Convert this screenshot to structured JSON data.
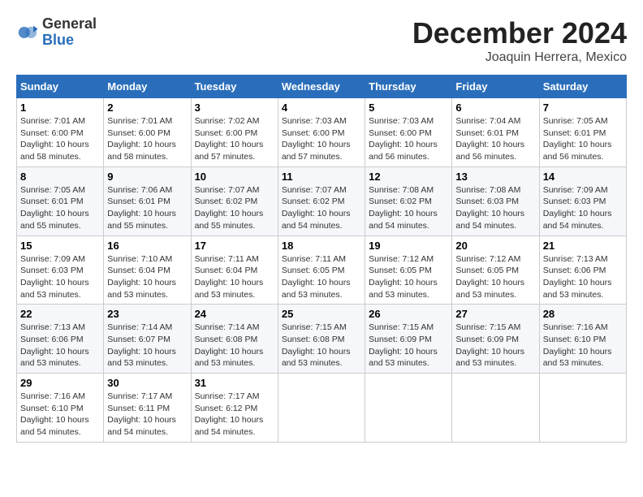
{
  "header": {
    "logo_general": "General",
    "logo_blue": "Blue",
    "title": "December 2024",
    "subtitle": "Joaquin Herrera, Mexico"
  },
  "days_of_week": [
    "Sunday",
    "Monday",
    "Tuesday",
    "Wednesday",
    "Thursday",
    "Friday",
    "Saturday"
  ],
  "weeks": [
    [
      {
        "day": "1",
        "sunrise": "7:01 AM",
        "sunset": "6:00 PM",
        "daylight": "10 hours and 58 minutes."
      },
      {
        "day": "2",
        "sunrise": "7:01 AM",
        "sunset": "6:00 PM",
        "daylight": "10 hours and 58 minutes."
      },
      {
        "day": "3",
        "sunrise": "7:02 AM",
        "sunset": "6:00 PM",
        "daylight": "10 hours and 57 minutes."
      },
      {
        "day": "4",
        "sunrise": "7:03 AM",
        "sunset": "6:00 PM",
        "daylight": "10 hours and 57 minutes."
      },
      {
        "day": "5",
        "sunrise": "7:03 AM",
        "sunset": "6:00 PM",
        "daylight": "10 hours and 56 minutes."
      },
      {
        "day": "6",
        "sunrise": "7:04 AM",
        "sunset": "6:01 PM",
        "daylight": "10 hours and 56 minutes."
      },
      {
        "day": "7",
        "sunrise": "7:05 AM",
        "sunset": "6:01 PM",
        "daylight": "10 hours and 56 minutes."
      }
    ],
    [
      {
        "day": "8",
        "sunrise": "7:05 AM",
        "sunset": "6:01 PM",
        "daylight": "10 hours and 55 minutes."
      },
      {
        "day": "9",
        "sunrise": "7:06 AM",
        "sunset": "6:01 PM",
        "daylight": "10 hours and 55 minutes."
      },
      {
        "day": "10",
        "sunrise": "7:07 AM",
        "sunset": "6:02 PM",
        "daylight": "10 hours and 55 minutes."
      },
      {
        "day": "11",
        "sunrise": "7:07 AM",
        "sunset": "6:02 PM",
        "daylight": "10 hours and 54 minutes."
      },
      {
        "day": "12",
        "sunrise": "7:08 AM",
        "sunset": "6:02 PM",
        "daylight": "10 hours and 54 minutes."
      },
      {
        "day": "13",
        "sunrise": "7:08 AM",
        "sunset": "6:03 PM",
        "daylight": "10 hours and 54 minutes."
      },
      {
        "day": "14",
        "sunrise": "7:09 AM",
        "sunset": "6:03 PM",
        "daylight": "10 hours and 54 minutes."
      }
    ],
    [
      {
        "day": "15",
        "sunrise": "7:09 AM",
        "sunset": "6:03 PM",
        "daylight": "10 hours and 53 minutes."
      },
      {
        "day": "16",
        "sunrise": "7:10 AM",
        "sunset": "6:04 PM",
        "daylight": "10 hours and 53 minutes."
      },
      {
        "day": "17",
        "sunrise": "7:11 AM",
        "sunset": "6:04 PM",
        "daylight": "10 hours and 53 minutes."
      },
      {
        "day": "18",
        "sunrise": "7:11 AM",
        "sunset": "6:05 PM",
        "daylight": "10 hours and 53 minutes."
      },
      {
        "day": "19",
        "sunrise": "7:12 AM",
        "sunset": "6:05 PM",
        "daylight": "10 hours and 53 minutes."
      },
      {
        "day": "20",
        "sunrise": "7:12 AM",
        "sunset": "6:05 PM",
        "daylight": "10 hours and 53 minutes."
      },
      {
        "day": "21",
        "sunrise": "7:13 AM",
        "sunset": "6:06 PM",
        "daylight": "10 hours and 53 minutes."
      }
    ],
    [
      {
        "day": "22",
        "sunrise": "7:13 AM",
        "sunset": "6:06 PM",
        "daylight": "10 hours and 53 minutes."
      },
      {
        "day": "23",
        "sunrise": "7:14 AM",
        "sunset": "6:07 PM",
        "daylight": "10 hours and 53 minutes."
      },
      {
        "day": "24",
        "sunrise": "7:14 AM",
        "sunset": "6:08 PM",
        "daylight": "10 hours and 53 minutes."
      },
      {
        "day": "25",
        "sunrise": "7:15 AM",
        "sunset": "6:08 PM",
        "daylight": "10 hours and 53 minutes."
      },
      {
        "day": "26",
        "sunrise": "7:15 AM",
        "sunset": "6:09 PM",
        "daylight": "10 hours and 53 minutes."
      },
      {
        "day": "27",
        "sunrise": "7:15 AM",
        "sunset": "6:09 PM",
        "daylight": "10 hours and 53 minutes."
      },
      {
        "day": "28",
        "sunrise": "7:16 AM",
        "sunset": "6:10 PM",
        "daylight": "10 hours and 53 minutes."
      }
    ],
    [
      {
        "day": "29",
        "sunrise": "7:16 AM",
        "sunset": "6:10 PM",
        "daylight": "10 hours and 54 minutes."
      },
      {
        "day": "30",
        "sunrise": "7:17 AM",
        "sunset": "6:11 PM",
        "daylight": "10 hours and 54 minutes."
      },
      {
        "day": "31",
        "sunrise": "7:17 AM",
        "sunset": "6:12 PM",
        "daylight": "10 hours and 54 minutes."
      },
      null,
      null,
      null,
      null
    ]
  ]
}
